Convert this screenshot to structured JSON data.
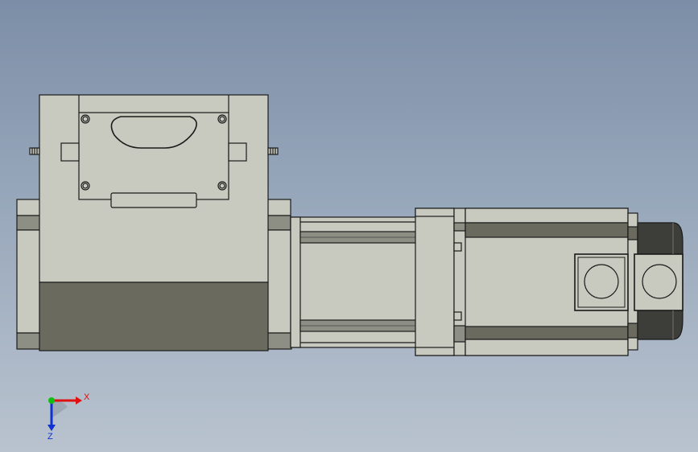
{
  "viewport": {
    "background_top": "#7c8ea7",
    "background_bottom": "#b9c3cf"
  },
  "model": {
    "part_color": "#c8c9bf",
    "shade_color": "#6b6a5f",
    "dark_color": "#3d3d3a",
    "edge_color": "#1a1a1a"
  },
  "triad": {
    "x_label": "X",
    "z_label": "Z",
    "x_color": "#e01010",
    "y_color": "#10c010",
    "z_color": "#1030d0"
  }
}
